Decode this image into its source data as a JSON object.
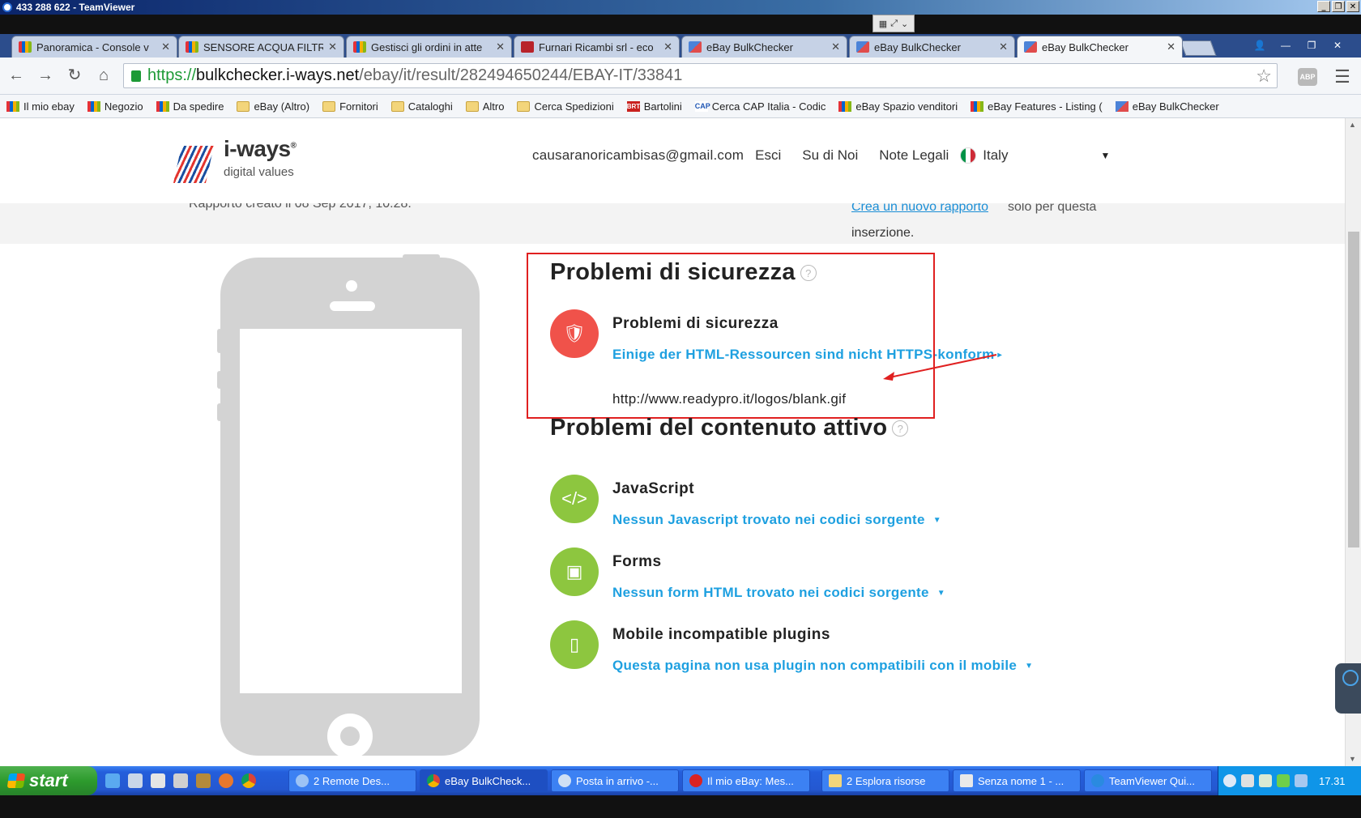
{
  "window": {
    "title": "433 288 622 - TeamViewer"
  },
  "tabs": [
    {
      "label": "Panoramica - Console v",
      "favicon": "ebay-icon"
    },
    {
      "label": "SENSORE ACQUA FILTR",
      "favicon": "ebay-icon"
    },
    {
      "label": "Gestisci gli ordini in atte",
      "favicon": "ebay-icon"
    },
    {
      "label": "Furnari Ricambi srl - eco",
      "favicon": "furnari-icon"
    },
    {
      "label": "eBay BulkChecker",
      "favicon": "bulkchecker-icon"
    },
    {
      "label": "eBay BulkChecker",
      "favicon": "bulkchecker-icon"
    },
    {
      "label": "eBay BulkChecker",
      "favicon": "bulkchecker-icon",
      "active": true
    }
  ],
  "address": {
    "protocol": "https://",
    "host": "bulkchecker.i-ways.net",
    "path": "/ebay/it/result/282494650244/EBAY-IT/33841"
  },
  "abp_label": "ABP",
  "bookmarks": [
    {
      "label": "Il mio ebay",
      "icon": "ebay"
    },
    {
      "label": "Negozio",
      "icon": "ebay"
    },
    {
      "label": "Da spedire",
      "icon": "ebay"
    },
    {
      "label": "eBay (Altro)",
      "icon": "folder"
    },
    {
      "label": "Fornitori",
      "icon": "folder"
    },
    {
      "label": "Cataloghi",
      "icon": "folder"
    },
    {
      "label": "Altro",
      "icon": "folder"
    },
    {
      "label": "Cerca Spedizioni",
      "icon": "folder"
    },
    {
      "label": "Bartolini",
      "icon": "brt"
    },
    {
      "label": "Cerca CAP Italia - Codic",
      "icon": "cap"
    },
    {
      "label": "eBay Spazio venditori",
      "icon": "ebay"
    },
    {
      "label": "eBay Features - Listing (",
      "icon": "ebay"
    },
    {
      "label": "eBay BulkChecker",
      "icon": "bc"
    }
  ],
  "bookmark_icon_text": {
    "brt": "BRT",
    "cap": "CAP"
  },
  "site": {
    "logo_brand": "i-ways",
    "logo_tagline": "digital values",
    "nav": {
      "email": "causaranoricambisas@gmail.com",
      "logout": "Esci",
      "about": "Su di Noi",
      "legal": "Note Legali",
      "country": "Italy"
    }
  },
  "report_band": {
    "created_text": "Rapporto creato il 08 Sep 2017, 10:28.",
    "new_report_link": "Crea un nuovo rapporto",
    "new_report_rest": "solo per questa",
    "new_report_rest2": "inserzione."
  },
  "security": {
    "section_title": "Problemi di sicurezza",
    "issue_title": "Problemi di sicurezza",
    "issue_link": "Einige der HTML-Ressourcen sind nicht HTTPS-konform",
    "issue_url": "http://www.readypro.it/logos/blank.gif"
  },
  "active_content": {
    "section_title": "Problemi del contenuto attivo",
    "items": [
      {
        "title": "JavaScript",
        "link": "Nessun Javascript trovato nei codici sorgente",
        "icon": "code-icon"
      },
      {
        "title": "Forms",
        "link": "Nessun form HTML trovato nei codici sorgente",
        "icon": "form-icon"
      },
      {
        "title": "Mobile incompatible plugins",
        "link": "Questa pagina non usa plugin non compatibili con il mobile",
        "icon": "mobile-icon"
      }
    ]
  },
  "taskbar": {
    "start_label": "start",
    "items": [
      {
        "label": "2 Remote Des..."
      },
      {
        "label": "eBay BulkCheck...",
        "active": true
      },
      {
        "label": "Posta in arrivo -..."
      },
      {
        "label": "Il mio eBay: Mes..."
      },
      {
        "label": "2 Esplora risorse"
      },
      {
        "label": "Senza nome 1 - ..."
      },
      {
        "label": "TeamViewer Qui..."
      }
    ],
    "clock": "17.31"
  },
  "colors": {
    "accent_link": "#1ea0e0",
    "security_red": "#f0524a",
    "ok_green": "#8dc63f",
    "highlight_box": "#e02020"
  }
}
